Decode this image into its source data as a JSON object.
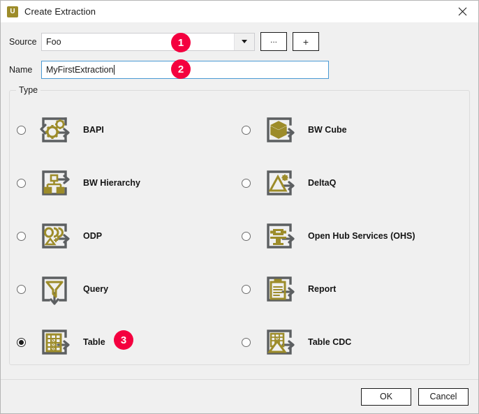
{
  "window": {
    "title": "Create Extraction",
    "app_icon": "u-logo-icon",
    "close_icon": "close-icon"
  },
  "form": {
    "source": {
      "label": "Source",
      "value": "Foo",
      "placeholder": "",
      "dropdown_icon": "chevron-down-icon"
    },
    "browse_button": {
      "label": "...",
      "icon": "ellipsis-icon"
    },
    "add_button": {
      "label": "+",
      "icon": "plus-icon"
    },
    "name": {
      "label": "Name",
      "value": "MyFirstExtraction",
      "placeholder": ""
    }
  },
  "type_group": {
    "legend": "Type",
    "selected": "Table",
    "options": [
      {
        "label": "BAPI",
        "icon": "bapi-gears-icon",
        "selected": false
      },
      {
        "label": "BW Cube",
        "icon": "bw-cube-icon",
        "selected": false
      },
      {
        "label": "BW Hierarchy",
        "icon": "bw-hierarchy-icon",
        "selected": false
      },
      {
        "label": "DeltaQ",
        "icon": "deltaq-triangle-icon",
        "selected": false
      },
      {
        "label": "ODP",
        "icon": "odp-icon",
        "selected": false
      },
      {
        "label": "Open Hub Services (OHS)",
        "icon": "open-hub-icon",
        "selected": false
      },
      {
        "label": "Query",
        "icon": "query-funnel-icon",
        "selected": false
      },
      {
        "label": "Report",
        "icon": "report-clipboard-icon",
        "selected": false
      },
      {
        "label": "Table",
        "icon": "table-grid-icon",
        "selected": true
      },
      {
        "label": "Table CDC",
        "icon": "table-cdc-icon",
        "selected": false
      }
    ]
  },
  "footer": {
    "ok_label": "OK",
    "cancel_label": "Cancel"
  },
  "annotations": [
    {
      "number": "1",
      "target": "source-combobox"
    },
    {
      "number": "2",
      "target": "name-textbox"
    },
    {
      "number": "3",
      "target": "type-option-table"
    }
  ],
  "colors": {
    "accent_gold": "#9d8c2a",
    "icon_frame_gray": "#5c5f61",
    "badge_red": "#f4003f",
    "focus_blue": "#4a9ad4",
    "window_bg": "#f0f0f0"
  }
}
